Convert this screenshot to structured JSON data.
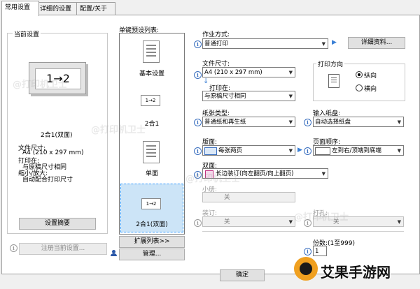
{
  "tabs": [
    {
      "label": "常用设置"
    },
    {
      "label": "详细的设置"
    },
    {
      "label": "配置/关于"
    }
  ],
  "current_settings": {
    "legend": "当前设置",
    "preview_text": "1→2",
    "preview_caption": "2合1(双面)",
    "summary_lines": [
      "文件尺寸:",
      "A4 (210 x 297 mm)",
      "打印在:",
      "与原稿尺寸相同",
      "缩小/放大:",
      "自动配合打印尺寸"
    ],
    "summary_button": "设置摘要",
    "register_button": "注册当前设置..."
  },
  "presets": {
    "legend": "单键预设列表:",
    "items": [
      {
        "label": "基本设置",
        "icon_text": ""
      },
      {
        "label": "2合1",
        "icon_text": "1→2"
      },
      {
        "label": "单面",
        "icon_text": ""
      },
      {
        "label": "2合1(双面)",
        "icon_text": "1→2"
      }
    ],
    "selected_index": 3,
    "expand_button": "扩展列表>>",
    "manage_button": "管理..."
  },
  "settings": {
    "job_type": {
      "label": "作业方式:",
      "value": "普通打印"
    },
    "details_button": "详细资料...",
    "page_size": {
      "label": "文件尺寸:",
      "value": "A4 (210 x 297 mm)"
    },
    "print_on": {
      "label": "打印在:",
      "value": "与原稿尺寸相同"
    },
    "orientation": {
      "legend": "打印方向",
      "options": [
        "纵向",
        "横向"
      ],
      "selected": "纵向"
    },
    "media_type": {
      "label": "纸张类型:",
      "value": "普通纸和再生纸"
    },
    "paper_source": {
      "label": "输入纸盘:",
      "value": "自动选择纸盘"
    },
    "layout": {
      "label": "版面:",
      "value": "每张两页"
    },
    "page_order": {
      "label": "页面顺序:",
      "value": "左到右/顶端到底端"
    },
    "duplex": {
      "label": "双面:",
      "value": "长边装订(向左翻页/向上翻页)"
    },
    "booklet": {
      "label": "小册:",
      "value": "关"
    },
    "staple": {
      "label": "装订:",
      "value": "关"
    },
    "punch": {
      "label": "打孔:",
      "value": "关"
    },
    "copies": {
      "label": "份数:(1至999)",
      "value": "1"
    }
  },
  "footer": {
    "ok_button": "确定"
  },
  "watermark": {
    "text": "@打印机卫士",
    "brand": "艾果手游网"
  }
}
